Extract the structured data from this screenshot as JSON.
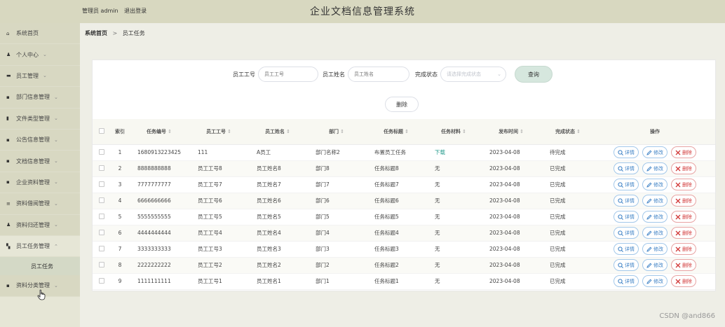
{
  "header": {
    "user_role": "管理员 admin",
    "logout": "退出登录",
    "title": "企业文档信息管理系统"
  },
  "sidebar": {
    "items": [
      {
        "label": "系统首页",
        "icon": "home-icon",
        "chev": ""
      },
      {
        "label": "个人中心",
        "icon": "person-icon",
        "chev": "⌄"
      },
      {
        "label": "员工管理",
        "icon": "user-icon",
        "chev": "⌄"
      },
      {
        "label": "部门信息管理",
        "icon": "grid-icon",
        "chev": "⌄"
      },
      {
        "label": "文件类型管理",
        "icon": "file-icon",
        "chev": "⌄"
      },
      {
        "label": "公告信息管理",
        "icon": "grid-icon",
        "chev": "⌄"
      },
      {
        "label": "文档信息管理",
        "icon": "grid-icon",
        "chev": "⌄"
      },
      {
        "label": "企业资料管理",
        "icon": "grid-icon",
        "chev": "⌄"
      },
      {
        "label": "资料借阅管理",
        "icon": "list-icon",
        "chev": "⌄"
      },
      {
        "label": "资料归还管理",
        "icon": "person-icon",
        "chev": "⌄"
      },
      {
        "label": "员工任务管理",
        "icon": "chart-icon",
        "chev": "⌃"
      },
      {
        "label": "资料分类管理",
        "icon": "grid-icon",
        "chev": "⌄"
      }
    ],
    "sub_item": "员工任务"
  },
  "breadcrumb": {
    "home": "系统首页",
    "separator": ">",
    "current": "员工任务"
  },
  "search": {
    "emp_no_label": "员工工号",
    "emp_no_placeholder": "员工工号",
    "emp_name_label": "员工姓名",
    "emp_name_placeholder": "员工姓名",
    "status_label": "完成状态",
    "status_placeholder": "请选择完成状态",
    "query_button": "查询"
  },
  "actions": {
    "delete_button": "删除"
  },
  "table": {
    "columns": [
      "索引",
      "任务编号",
      "员工工号",
      "员工姓名",
      "部门",
      "任务标题",
      "任务材料",
      "发布时间",
      "完成状态",
      "操作"
    ],
    "rows": [
      {
        "idx": "1",
        "task_no": "1680913223425",
        "emp_no": "111",
        "emp_name": "A员工",
        "dept": "部门名称2",
        "title": "布置员工任务",
        "material": "下载",
        "date": "2023-04-08",
        "status": "待完成"
      },
      {
        "idx": "2",
        "task_no": "8888888888",
        "emp_no": "员工工号8",
        "emp_name": "员工姓名8",
        "dept": "部门8",
        "title": "任务标题8",
        "material": "无",
        "date": "2023-04-08",
        "status": "已完成"
      },
      {
        "idx": "3",
        "task_no": "7777777777",
        "emp_no": "员工工号7",
        "emp_name": "员工姓名7",
        "dept": "部门7",
        "title": "任务标题7",
        "material": "无",
        "date": "2023-04-08",
        "status": "已完成"
      },
      {
        "idx": "4",
        "task_no": "6666666666",
        "emp_no": "员工工号6",
        "emp_name": "员工姓名6",
        "dept": "部门6",
        "title": "任务标题6",
        "material": "无",
        "date": "2023-04-08",
        "status": "已完成"
      },
      {
        "idx": "5",
        "task_no": "5555555555",
        "emp_no": "员工工号5",
        "emp_name": "员工姓名5",
        "dept": "部门5",
        "title": "任务标题5",
        "material": "无",
        "date": "2023-04-08",
        "status": "已完成"
      },
      {
        "idx": "6",
        "task_no": "4444444444",
        "emp_no": "员工工号4",
        "emp_name": "员工姓名4",
        "dept": "部门4",
        "title": "任务标题4",
        "material": "无",
        "date": "2023-04-08",
        "status": "已完成"
      },
      {
        "idx": "7",
        "task_no": "3333333333",
        "emp_no": "员工工号3",
        "emp_name": "员工姓名3",
        "dept": "部门3",
        "title": "任务标题3",
        "material": "无",
        "date": "2023-04-08",
        "status": "已完成"
      },
      {
        "idx": "8",
        "task_no": "2222222222",
        "emp_no": "员工工号2",
        "emp_name": "员工姓名2",
        "dept": "部门2",
        "title": "任务标题2",
        "material": "无",
        "date": "2023-04-08",
        "status": "已完成"
      },
      {
        "idx": "9",
        "task_no": "1111111111",
        "emp_no": "员工工号1",
        "emp_name": "员工姓名1",
        "dept": "部门1",
        "title": "任务标题1",
        "material": "无",
        "date": "2023-04-08",
        "status": "已完成"
      }
    ],
    "op_labels": {
      "detail": "详情",
      "edit": "修改",
      "remove": "删除"
    }
  },
  "watermark": "CSDN @and866"
}
